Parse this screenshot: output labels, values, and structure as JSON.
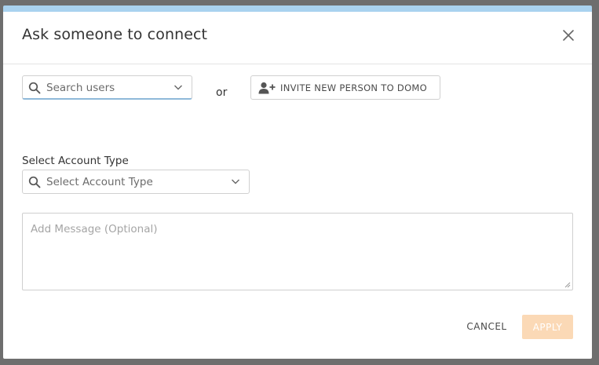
{
  "dialog": {
    "title": "Ask someone to connect"
  },
  "search_users": {
    "placeholder": "Search users"
  },
  "or_text": "or",
  "invite_button": {
    "label": "INVITE NEW PERSON TO DOMO"
  },
  "account_type": {
    "label": "Select Account Type",
    "placeholder": "Select Account Type"
  },
  "message": {
    "placeholder": "Add Message (Optional)"
  },
  "actions": {
    "cancel_label": "CANCEL",
    "apply_label": "APPLY"
  },
  "colors": {
    "header_accent": "#a9d2ef",
    "apply_disabled": "#fbd9b6",
    "overlay": "#6e6e6e"
  }
}
